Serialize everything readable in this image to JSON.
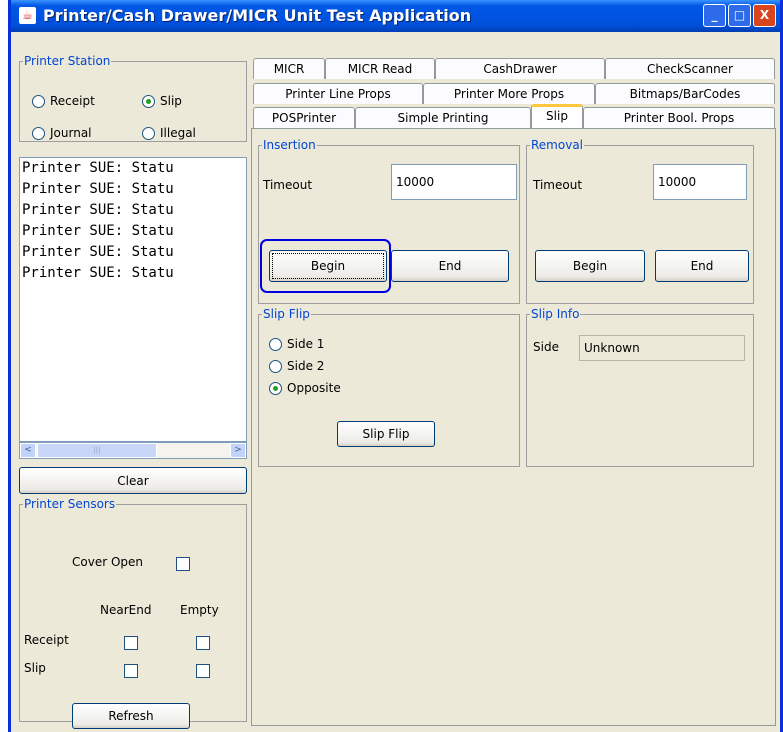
{
  "window": {
    "title": "Printer/Cash Drawer/MICR Unit Test Application",
    "buttons": {
      "minimize": "_",
      "maximize": "□",
      "close": "X"
    }
  },
  "printer_station": {
    "legend": "Printer Station",
    "options": [
      {
        "label": "Receipt",
        "selected": false
      },
      {
        "label": "Slip",
        "selected": true
      },
      {
        "label": "Journal",
        "selected": false
      },
      {
        "label": "Illegal",
        "selected": false
      }
    ]
  },
  "log": {
    "lines": [
      "Printer SUE: Statu",
      "Printer SUE: Statu",
      "Printer SUE: Statu",
      "Printer SUE: Statu",
      "Printer SUE: Statu",
      "Printer SUE: Statu"
    ]
  },
  "scroll": {
    "left": "<",
    "right": ">",
    "grip": "|||"
  },
  "clear_label": "Clear",
  "sensors": {
    "legend": "Printer Sensors",
    "cover_open": "Cover Open",
    "near_end": "NearEnd",
    "empty": "Empty",
    "receipt": "Receipt",
    "slip": "Slip",
    "refresh": "Refresh"
  },
  "tabs": {
    "row1": [
      "MICR",
      "MICR Read",
      "CashDrawer",
      "CheckScanner"
    ],
    "row2": [
      "Printer Line Props",
      "Printer More Props",
      "Bitmaps/BarCodes"
    ],
    "row3": [
      "POSPrinter",
      "Simple Printing",
      "Slip",
      "Printer Bool. Props"
    ],
    "active": "Slip"
  },
  "insertion": {
    "legend": "Insertion",
    "timeout_label": "Timeout",
    "timeout_value": "10000",
    "begin": "Begin",
    "end": "End"
  },
  "removal": {
    "legend": "Removal",
    "timeout_label": "Timeout",
    "timeout_value": "10000",
    "begin": "Begin",
    "end": "End"
  },
  "slip_flip": {
    "legend": "Slip Flip",
    "options": [
      {
        "label": "Side 1",
        "selected": false
      },
      {
        "label": "Side 2",
        "selected": false
      },
      {
        "label": "Opposite",
        "selected": true
      }
    ],
    "button": "Slip Flip"
  },
  "slip_info": {
    "legend": "Slip Info",
    "side_label": "Side",
    "side_value": "Unknown"
  },
  "colors": {
    "title_bar": "#0054E3",
    "legend": "#0046D5",
    "focus_highlight": "#0000E0"
  }
}
